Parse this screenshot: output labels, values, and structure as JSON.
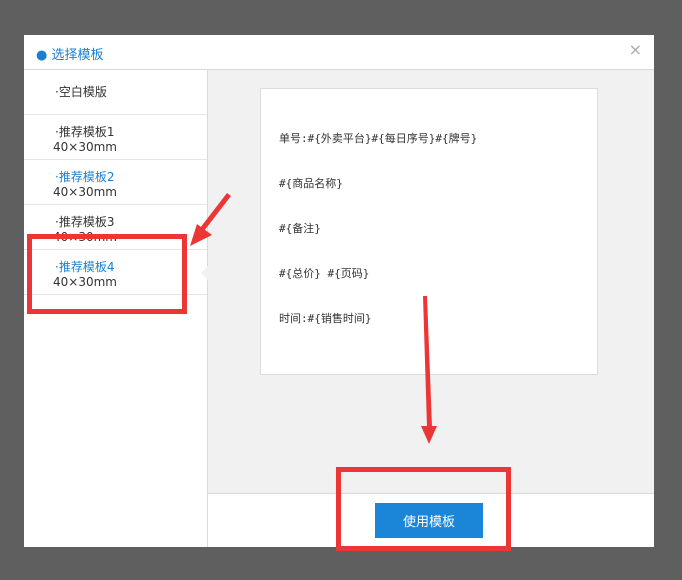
{
  "dialog": {
    "title": "● 选择模板",
    "close_glyph": "×"
  },
  "sidebar": {
    "items": [
      {
        "label": "·空白模版",
        "size": ""
      },
      {
        "label": "·推荐模板1",
        "size": "40×30mm"
      },
      {
        "label": "·推荐模板2",
        "size": "40×30mm"
      },
      {
        "label": "·推荐模板3",
        "size": "40×30mm"
      },
      {
        "label": "·推荐模板4",
        "size": "40×30mm"
      }
    ],
    "active_index": 4
  },
  "preview": {
    "lines": [
      "单号:#{外卖平台}#{每日序号}#{牌号}",
      "#{商品名称}",
      "#{备注}",
      "#{总价} #{页码}",
      "时间:#{销售时间}"
    ]
  },
  "footer": {
    "use_label": "使用模板"
  },
  "colors": {
    "accent": "#1b7fd1",
    "button": "#1b85d8",
    "annotation": "#ee3536",
    "overlay": "#5f5f5f"
  }
}
